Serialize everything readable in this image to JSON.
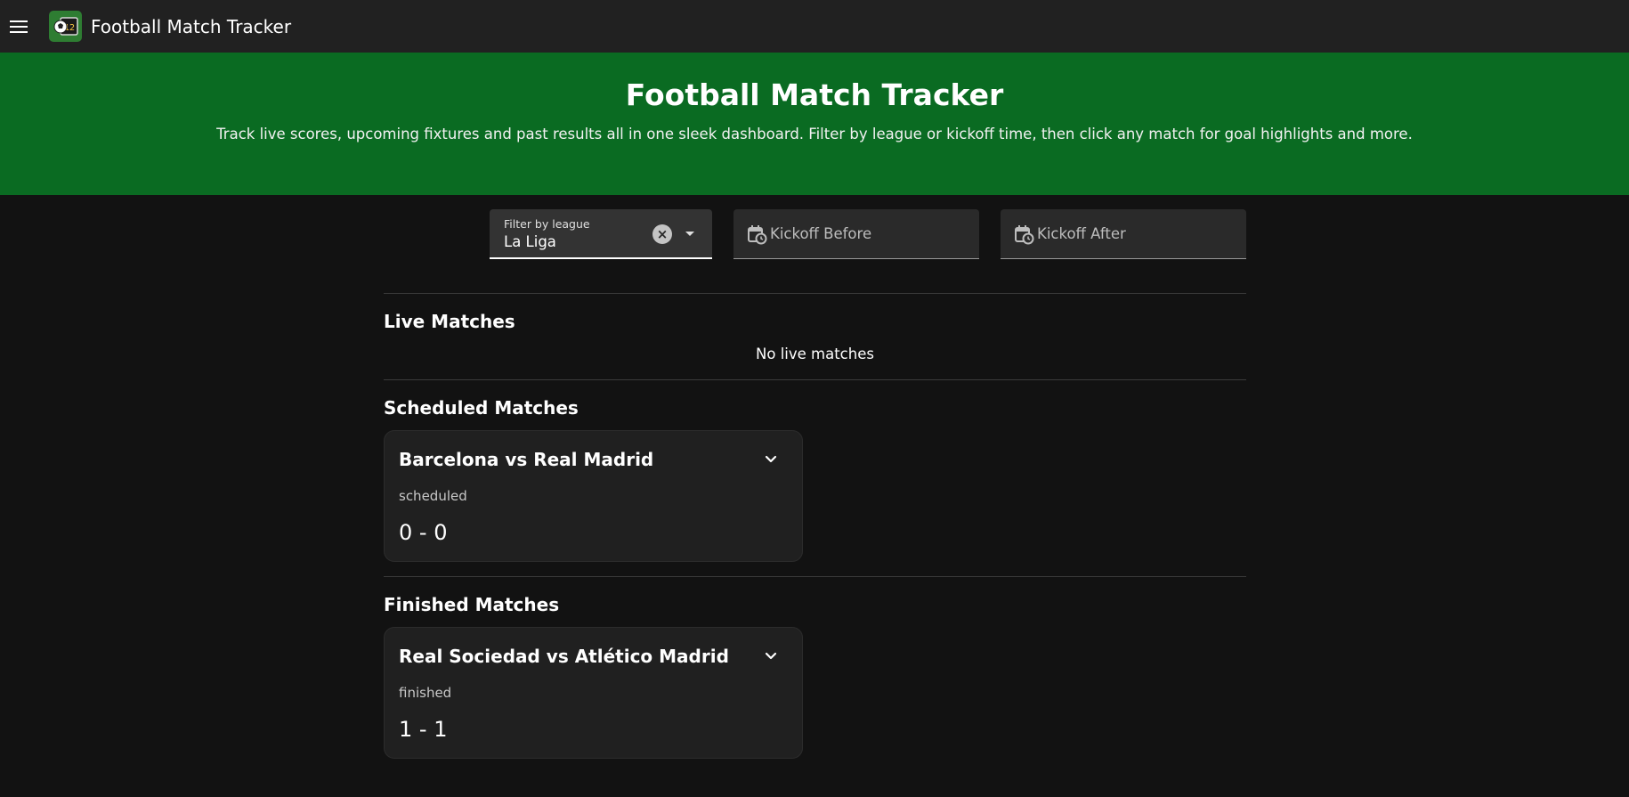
{
  "appbar": {
    "title": "Football Match Tracker",
    "menu_icon": "menu-icon",
    "logo_icon": "football-scoreboard-icon"
  },
  "hero": {
    "title": "Football Match Tracker",
    "subtitle": "Track live scores, upcoming fixtures and past results all in one sleek dashboard. Filter by league or kickoff time, then click any match for goal highlights and more."
  },
  "filters": {
    "league": {
      "label": "Filter by league",
      "value": "La Liga"
    },
    "kickoff_before": {
      "placeholder": "Kickoff Before",
      "icon": "calendar-clock-icon"
    },
    "kickoff_after": {
      "placeholder": "Kickoff After",
      "icon": "calendar-clock-icon"
    }
  },
  "sections": {
    "live": {
      "title": "Live Matches",
      "empty_text": "No live matches"
    },
    "scheduled": {
      "title": "Scheduled Matches",
      "matches": [
        {
          "teams": "Barcelona vs Real Madrid",
          "status": "scheduled",
          "score": "0 - 0"
        }
      ]
    },
    "finished": {
      "title": "Finished Matches",
      "matches": [
        {
          "teams": "Real Sociedad vs Atlético Madrid",
          "status": "finished",
          "score": "1 - 1"
        }
      ]
    }
  },
  "colors": {
    "background": "#121212",
    "appbar": "#212121",
    "hero": "#0a6b22",
    "card": "#202020"
  }
}
